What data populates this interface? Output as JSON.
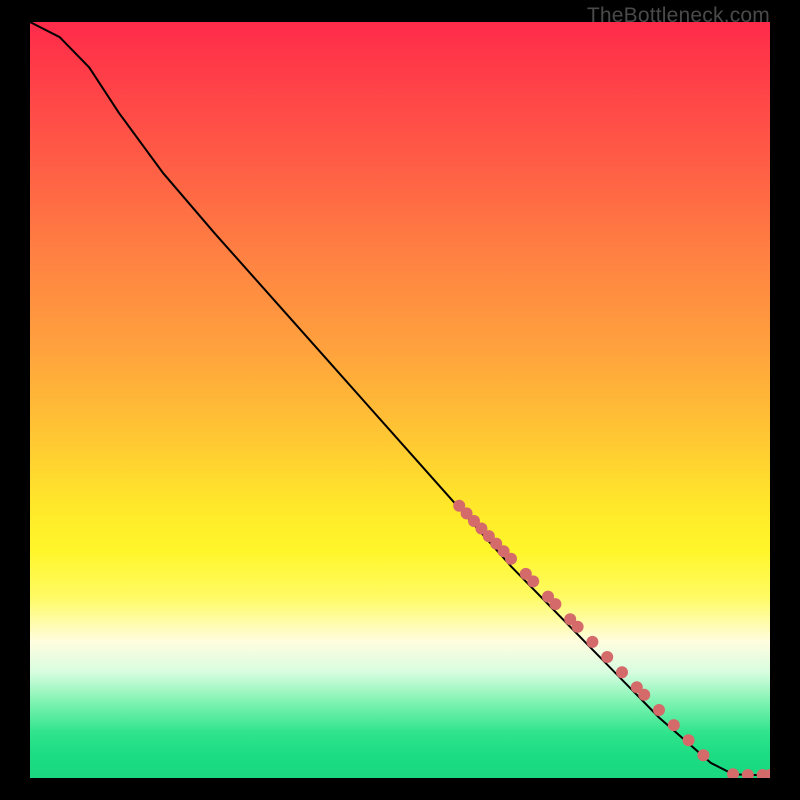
{
  "watermark": "TheBottleneck.com",
  "chart_data": {
    "type": "line",
    "title": "",
    "xlabel": "",
    "ylabel": "",
    "xlim": [
      0,
      100
    ],
    "ylim": [
      0,
      100
    ],
    "grid": false,
    "series": [
      {
        "name": "curve",
        "type": "line",
        "x": [
          0,
          4,
          8,
          12,
          18,
          25,
          35,
          45,
          55,
          65,
          75,
          85,
          92,
          95,
          97,
          100
        ],
        "y": [
          100,
          98,
          94,
          88,
          80,
          72,
          61,
          50,
          39,
          28,
          18,
          8,
          2,
          0.5,
          0.4,
          0.4
        ]
      },
      {
        "name": "points",
        "type": "scatter",
        "x": [
          58,
          59,
          60,
          61,
          62,
          63,
          64,
          65,
          67,
          68,
          70,
          71,
          73,
          74,
          76,
          78,
          80,
          82,
          83,
          85,
          87,
          89,
          91,
          95,
          97,
          99,
          100
        ],
        "y": [
          36,
          35,
          34,
          33,
          32,
          31,
          30,
          29,
          27,
          26,
          24,
          23,
          21,
          20,
          18,
          16,
          14,
          12,
          11,
          9,
          7,
          5,
          3,
          0.5,
          0.4,
          0.4,
          0.4
        ]
      }
    ],
    "colors": {
      "curve_stroke": "#000000",
      "point_fill": "#d46a6a"
    }
  }
}
